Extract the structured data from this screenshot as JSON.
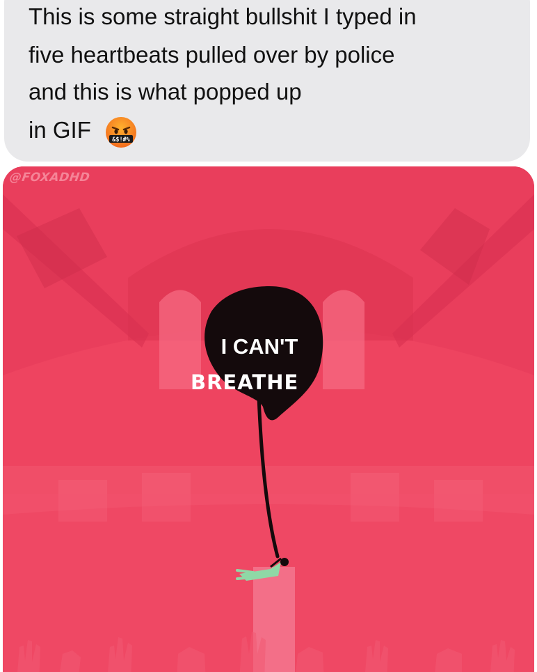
{
  "message": {
    "lines": [
      "This is some straight bullshit I typed in",
      "five heartbeats pulled over by police",
      "and this is what popped up",
      "in GIF"
    ],
    "emoji": "face-with-symbols-on-mouth",
    "emoji_symbols": "&$!#%"
  },
  "gif": {
    "watermark": "@FOXADHD",
    "speech_line_1": "I CAN'T",
    "speech_line_2": "BREATHE"
  },
  "colors": {
    "bubble_background": "#e9e9eb",
    "message_text": "#111111",
    "gif_background": "#ee4460",
    "speech_bubble": "#140a0c",
    "figure_shirt": "#8fd8a6"
  }
}
